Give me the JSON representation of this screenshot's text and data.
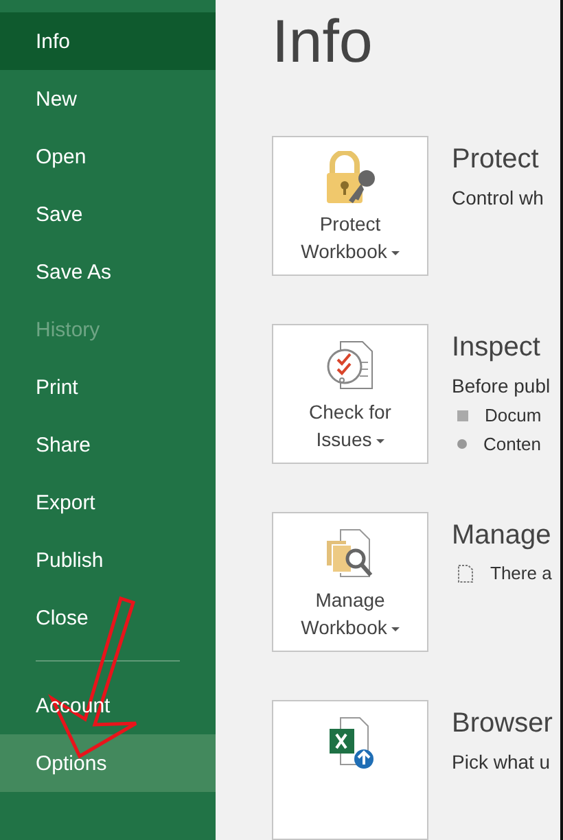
{
  "sidebar": {
    "items": [
      {
        "label": "Info",
        "selected": true,
        "disabled": false,
        "highlighted": false
      },
      {
        "label": "New",
        "selected": false,
        "disabled": false,
        "highlighted": false
      },
      {
        "label": "Open",
        "selected": false,
        "disabled": false,
        "highlighted": false
      },
      {
        "label": "Save",
        "selected": false,
        "disabled": false,
        "highlighted": false
      },
      {
        "label": "Save As",
        "selected": false,
        "disabled": false,
        "highlighted": false
      },
      {
        "label": "History",
        "selected": false,
        "disabled": true,
        "highlighted": false
      },
      {
        "label": "Print",
        "selected": false,
        "disabled": false,
        "highlighted": false
      },
      {
        "label": "Share",
        "selected": false,
        "disabled": false,
        "highlighted": false
      },
      {
        "label": "Export",
        "selected": false,
        "disabled": false,
        "highlighted": false
      },
      {
        "label": "Publish",
        "selected": false,
        "disabled": false,
        "highlighted": false
      },
      {
        "label": "Close",
        "selected": false,
        "disabled": false,
        "highlighted": false
      }
    ],
    "bottom_items": [
      {
        "label": "Account",
        "selected": false,
        "disabled": false,
        "highlighted": false
      },
      {
        "label": "Options",
        "selected": false,
        "disabled": false,
        "highlighted": true
      }
    ]
  },
  "title": "Info",
  "sections": [
    {
      "kind": "protect",
      "button_lines": [
        "Protect",
        "Workbook"
      ],
      "heading": "Protect",
      "description": "Control wh"
    },
    {
      "kind": "inspect",
      "button_lines": [
        "Check for",
        "Issues"
      ],
      "heading": "Inspect",
      "description": "Before publ",
      "bullets": [
        {
          "kind": "square",
          "text": "Docum"
        },
        {
          "kind": "circle",
          "text": "Conten"
        }
      ]
    },
    {
      "kind": "manage",
      "button_lines": [
        "Manage",
        "Workbook"
      ],
      "heading": "Manage",
      "bullets": [
        {
          "kind": "document",
          "text": "There a"
        }
      ]
    },
    {
      "kind": "browser",
      "heading": "Browser",
      "description": "Pick what u"
    }
  ]
}
